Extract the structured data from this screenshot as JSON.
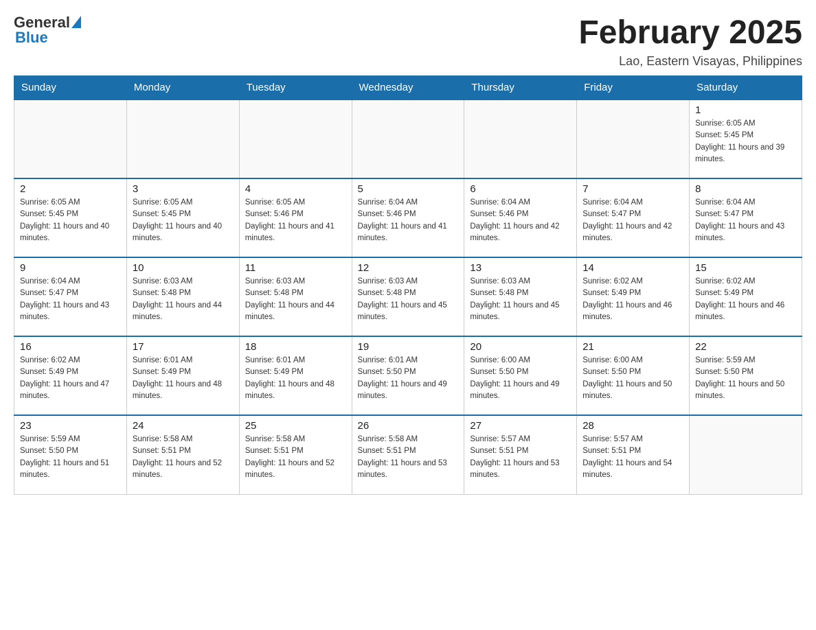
{
  "logo": {
    "general": "General",
    "blue": "Blue"
  },
  "header": {
    "title": "February 2025",
    "location": "Lao, Eastern Visayas, Philippines"
  },
  "weekdays": [
    "Sunday",
    "Monday",
    "Tuesday",
    "Wednesday",
    "Thursday",
    "Friday",
    "Saturday"
  ],
  "weeks": [
    [
      {
        "day": "",
        "sunrise": "",
        "sunset": "",
        "daylight": ""
      },
      {
        "day": "",
        "sunrise": "",
        "sunset": "",
        "daylight": ""
      },
      {
        "day": "",
        "sunrise": "",
        "sunset": "",
        "daylight": ""
      },
      {
        "day": "",
        "sunrise": "",
        "sunset": "",
        "daylight": ""
      },
      {
        "day": "",
        "sunrise": "",
        "sunset": "",
        "daylight": ""
      },
      {
        "day": "",
        "sunrise": "",
        "sunset": "",
        "daylight": ""
      },
      {
        "day": "1",
        "sunrise": "Sunrise: 6:05 AM",
        "sunset": "Sunset: 5:45 PM",
        "daylight": "Daylight: 11 hours and 39 minutes."
      }
    ],
    [
      {
        "day": "2",
        "sunrise": "Sunrise: 6:05 AM",
        "sunset": "Sunset: 5:45 PM",
        "daylight": "Daylight: 11 hours and 40 minutes."
      },
      {
        "day": "3",
        "sunrise": "Sunrise: 6:05 AM",
        "sunset": "Sunset: 5:45 PM",
        "daylight": "Daylight: 11 hours and 40 minutes."
      },
      {
        "day": "4",
        "sunrise": "Sunrise: 6:05 AM",
        "sunset": "Sunset: 5:46 PM",
        "daylight": "Daylight: 11 hours and 41 minutes."
      },
      {
        "day": "5",
        "sunrise": "Sunrise: 6:04 AM",
        "sunset": "Sunset: 5:46 PM",
        "daylight": "Daylight: 11 hours and 41 minutes."
      },
      {
        "day": "6",
        "sunrise": "Sunrise: 6:04 AM",
        "sunset": "Sunset: 5:46 PM",
        "daylight": "Daylight: 11 hours and 42 minutes."
      },
      {
        "day": "7",
        "sunrise": "Sunrise: 6:04 AM",
        "sunset": "Sunset: 5:47 PM",
        "daylight": "Daylight: 11 hours and 42 minutes."
      },
      {
        "day": "8",
        "sunrise": "Sunrise: 6:04 AM",
        "sunset": "Sunset: 5:47 PM",
        "daylight": "Daylight: 11 hours and 43 minutes."
      }
    ],
    [
      {
        "day": "9",
        "sunrise": "Sunrise: 6:04 AM",
        "sunset": "Sunset: 5:47 PM",
        "daylight": "Daylight: 11 hours and 43 minutes."
      },
      {
        "day": "10",
        "sunrise": "Sunrise: 6:03 AM",
        "sunset": "Sunset: 5:48 PM",
        "daylight": "Daylight: 11 hours and 44 minutes."
      },
      {
        "day": "11",
        "sunrise": "Sunrise: 6:03 AM",
        "sunset": "Sunset: 5:48 PM",
        "daylight": "Daylight: 11 hours and 44 minutes."
      },
      {
        "day": "12",
        "sunrise": "Sunrise: 6:03 AM",
        "sunset": "Sunset: 5:48 PM",
        "daylight": "Daylight: 11 hours and 45 minutes."
      },
      {
        "day": "13",
        "sunrise": "Sunrise: 6:03 AM",
        "sunset": "Sunset: 5:48 PM",
        "daylight": "Daylight: 11 hours and 45 minutes."
      },
      {
        "day": "14",
        "sunrise": "Sunrise: 6:02 AM",
        "sunset": "Sunset: 5:49 PM",
        "daylight": "Daylight: 11 hours and 46 minutes."
      },
      {
        "day": "15",
        "sunrise": "Sunrise: 6:02 AM",
        "sunset": "Sunset: 5:49 PM",
        "daylight": "Daylight: 11 hours and 46 minutes."
      }
    ],
    [
      {
        "day": "16",
        "sunrise": "Sunrise: 6:02 AM",
        "sunset": "Sunset: 5:49 PM",
        "daylight": "Daylight: 11 hours and 47 minutes."
      },
      {
        "day": "17",
        "sunrise": "Sunrise: 6:01 AM",
        "sunset": "Sunset: 5:49 PM",
        "daylight": "Daylight: 11 hours and 48 minutes."
      },
      {
        "day": "18",
        "sunrise": "Sunrise: 6:01 AM",
        "sunset": "Sunset: 5:49 PM",
        "daylight": "Daylight: 11 hours and 48 minutes."
      },
      {
        "day": "19",
        "sunrise": "Sunrise: 6:01 AM",
        "sunset": "Sunset: 5:50 PM",
        "daylight": "Daylight: 11 hours and 49 minutes."
      },
      {
        "day": "20",
        "sunrise": "Sunrise: 6:00 AM",
        "sunset": "Sunset: 5:50 PM",
        "daylight": "Daylight: 11 hours and 49 minutes."
      },
      {
        "day": "21",
        "sunrise": "Sunrise: 6:00 AM",
        "sunset": "Sunset: 5:50 PM",
        "daylight": "Daylight: 11 hours and 50 minutes."
      },
      {
        "day": "22",
        "sunrise": "Sunrise: 5:59 AM",
        "sunset": "Sunset: 5:50 PM",
        "daylight": "Daylight: 11 hours and 50 minutes."
      }
    ],
    [
      {
        "day": "23",
        "sunrise": "Sunrise: 5:59 AM",
        "sunset": "Sunset: 5:50 PM",
        "daylight": "Daylight: 11 hours and 51 minutes."
      },
      {
        "day": "24",
        "sunrise": "Sunrise: 5:58 AM",
        "sunset": "Sunset: 5:51 PM",
        "daylight": "Daylight: 11 hours and 52 minutes."
      },
      {
        "day": "25",
        "sunrise": "Sunrise: 5:58 AM",
        "sunset": "Sunset: 5:51 PM",
        "daylight": "Daylight: 11 hours and 52 minutes."
      },
      {
        "day": "26",
        "sunrise": "Sunrise: 5:58 AM",
        "sunset": "Sunset: 5:51 PM",
        "daylight": "Daylight: 11 hours and 53 minutes."
      },
      {
        "day": "27",
        "sunrise": "Sunrise: 5:57 AM",
        "sunset": "Sunset: 5:51 PM",
        "daylight": "Daylight: 11 hours and 53 minutes."
      },
      {
        "day": "28",
        "sunrise": "Sunrise: 5:57 AM",
        "sunset": "Sunset: 5:51 PM",
        "daylight": "Daylight: 11 hours and 54 minutes."
      },
      {
        "day": "",
        "sunrise": "",
        "sunset": "",
        "daylight": ""
      }
    ]
  ]
}
